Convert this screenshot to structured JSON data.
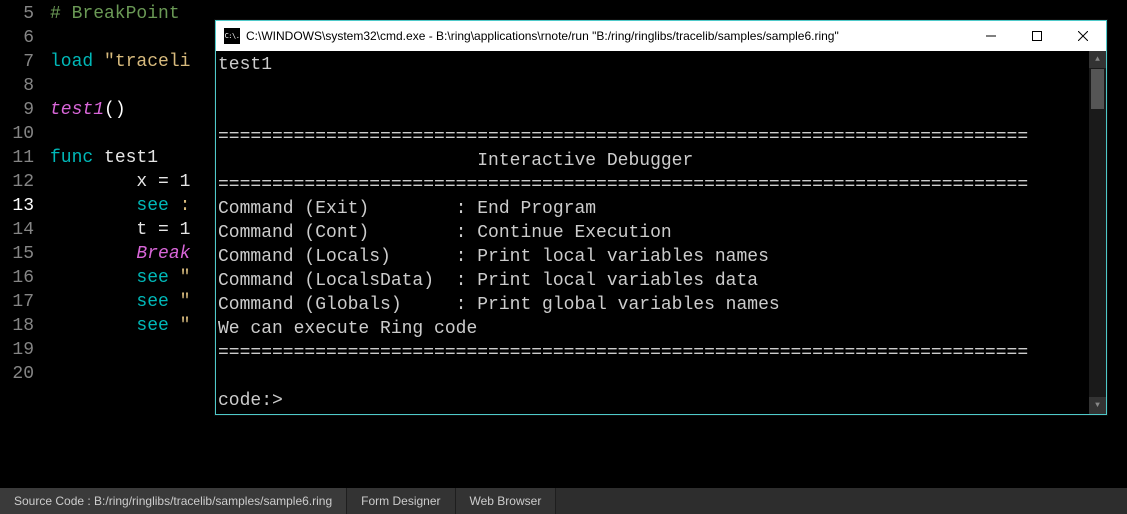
{
  "editor": {
    "lines": [
      {
        "n": 5,
        "tokens": [
          {
            "c": "comment",
            "t": "# BreakPoint"
          }
        ]
      },
      {
        "n": 6,
        "tokens": []
      },
      {
        "n": 7,
        "tokens": [
          {
            "c": "keyword",
            "t": "load "
          },
          {
            "c": "string",
            "t": "\"traceli"
          }
        ]
      },
      {
        "n": 8,
        "tokens": []
      },
      {
        "n": 9,
        "tokens": [
          {
            "c": "func",
            "t": "test1"
          },
          {
            "c": "paren",
            "t": "()"
          }
        ]
      },
      {
        "n": 10,
        "tokens": []
      },
      {
        "n": 11,
        "tokens": [
          {
            "c": "keyword",
            "t": "func "
          },
          {
            "c": "ident",
            "t": "test1"
          }
        ]
      },
      {
        "n": 12,
        "indent": 8,
        "tokens": [
          {
            "c": "ident",
            "t": "x = 1"
          }
        ]
      },
      {
        "n": 13,
        "indent": 8,
        "tokens": [
          {
            "c": "keyword",
            "t": "see "
          },
          {
            "c": "string",
            "t": ":"
          }
        ]
      },
      {
        "n": 14,
        "indent": 8,
        "tokens": [
          {
            "c": "ident",
            "t": "t = 1"
          }
        ]
      },
      {
        "n": 15,
        "indent": 8,
        "tokens": [
          {
            "c": "break",
            "t": "Break"
          }
        ]
      },
      {
        "n": 16,
        "indent": 8,
        "tokens": [
          {
            "c": "keyword",
            "t": "see "
          },
          {
            "c": "string",
            "t": "\""
          }
        ]
      },
      {
        "n": 17,
        "indent": 8,
        "tokens": [
          {
            "c": "keyword",
            "t": "see "
          },
          {
            "c": "string",
            "t": "\""
          }
        ]
      },
      {
        "n": 18,
        "indent": 8,
        "tokens": [
          {
            "c": "keyword",
            "t": "see "
          },
          {
            "c": "string",
            "t": "\""
          }
        ]
      },
      {
        "n": 19,
        "tokens": []
      },
      {
        "n": 20,
        "tokens": []
      }
    ],
    "current_line": 13
  },
  "statusbar": {
    "source_label": "Source Code : B:/ring/ringlibs/tracelib/samples/sample6.ring",
    "form_designer": "Form Designer",
    "web_browser": "Web Browser"
  },
  "cmd": {
    "icon_text": "C:\\.",
    "title": "C:\\WINDOWS\\system32\\cmd.exe - B:\\ring\\applications\\rnote/run  \"B:/ring/ringlibs/tracelib/samples/sample6.ring\"",
    "body": "test1\n\n\n===========================================================================\n                        Interactive Debugger\n===========================================================================\nCommand (Exit)        : End Program\nCommand (Cont)        : Continue Execution\nCommand (Locals)      : Print local variables names\nCommand (LocalsData)  : Print local variables data\nCommand (Globals)     : Print global variables names\nWe can execute Ring code\n===========================================================================\n\ncode:>"
  }
}
